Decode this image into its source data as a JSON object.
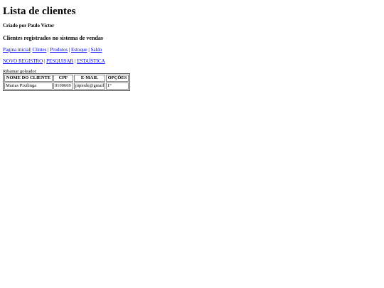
{
  "page": {
    "title": "Lista de clientes",
    "byline": "Criado por Paulo Victor",
    "subtitle": "Clientes registrados no sistema de vendas"
  },
  "nav_primary": [
    {
      "label": "Pagina inicial"
    },
    {
      "label": "Clintes"
    },
    {
      "label": "Produtos"
    },
    {
      "label": "Estoque"
    },
    {
      "label": "Saldo"
    }
  ],
  "nav_secondary": [
    {
      "label": "NOVO REGISTRO"
    },
    {
      "label": "PESQUISAR"
    },
    {
      "label": "ESTAÍSTICA"
    }
  ],
  "table": {
    "caption": "Ribamar goleador",
    "headers": [
      "NOME DO CLIENTE",
      "CPF",
      "E-MAIL",
      "OPÇÕES"
    ],
    "rows": [
      [
        "Marias Pixilinga",
        "0100669",
        "pipiode@gmail",
        "1°"
      ]
    ]
  }
}
